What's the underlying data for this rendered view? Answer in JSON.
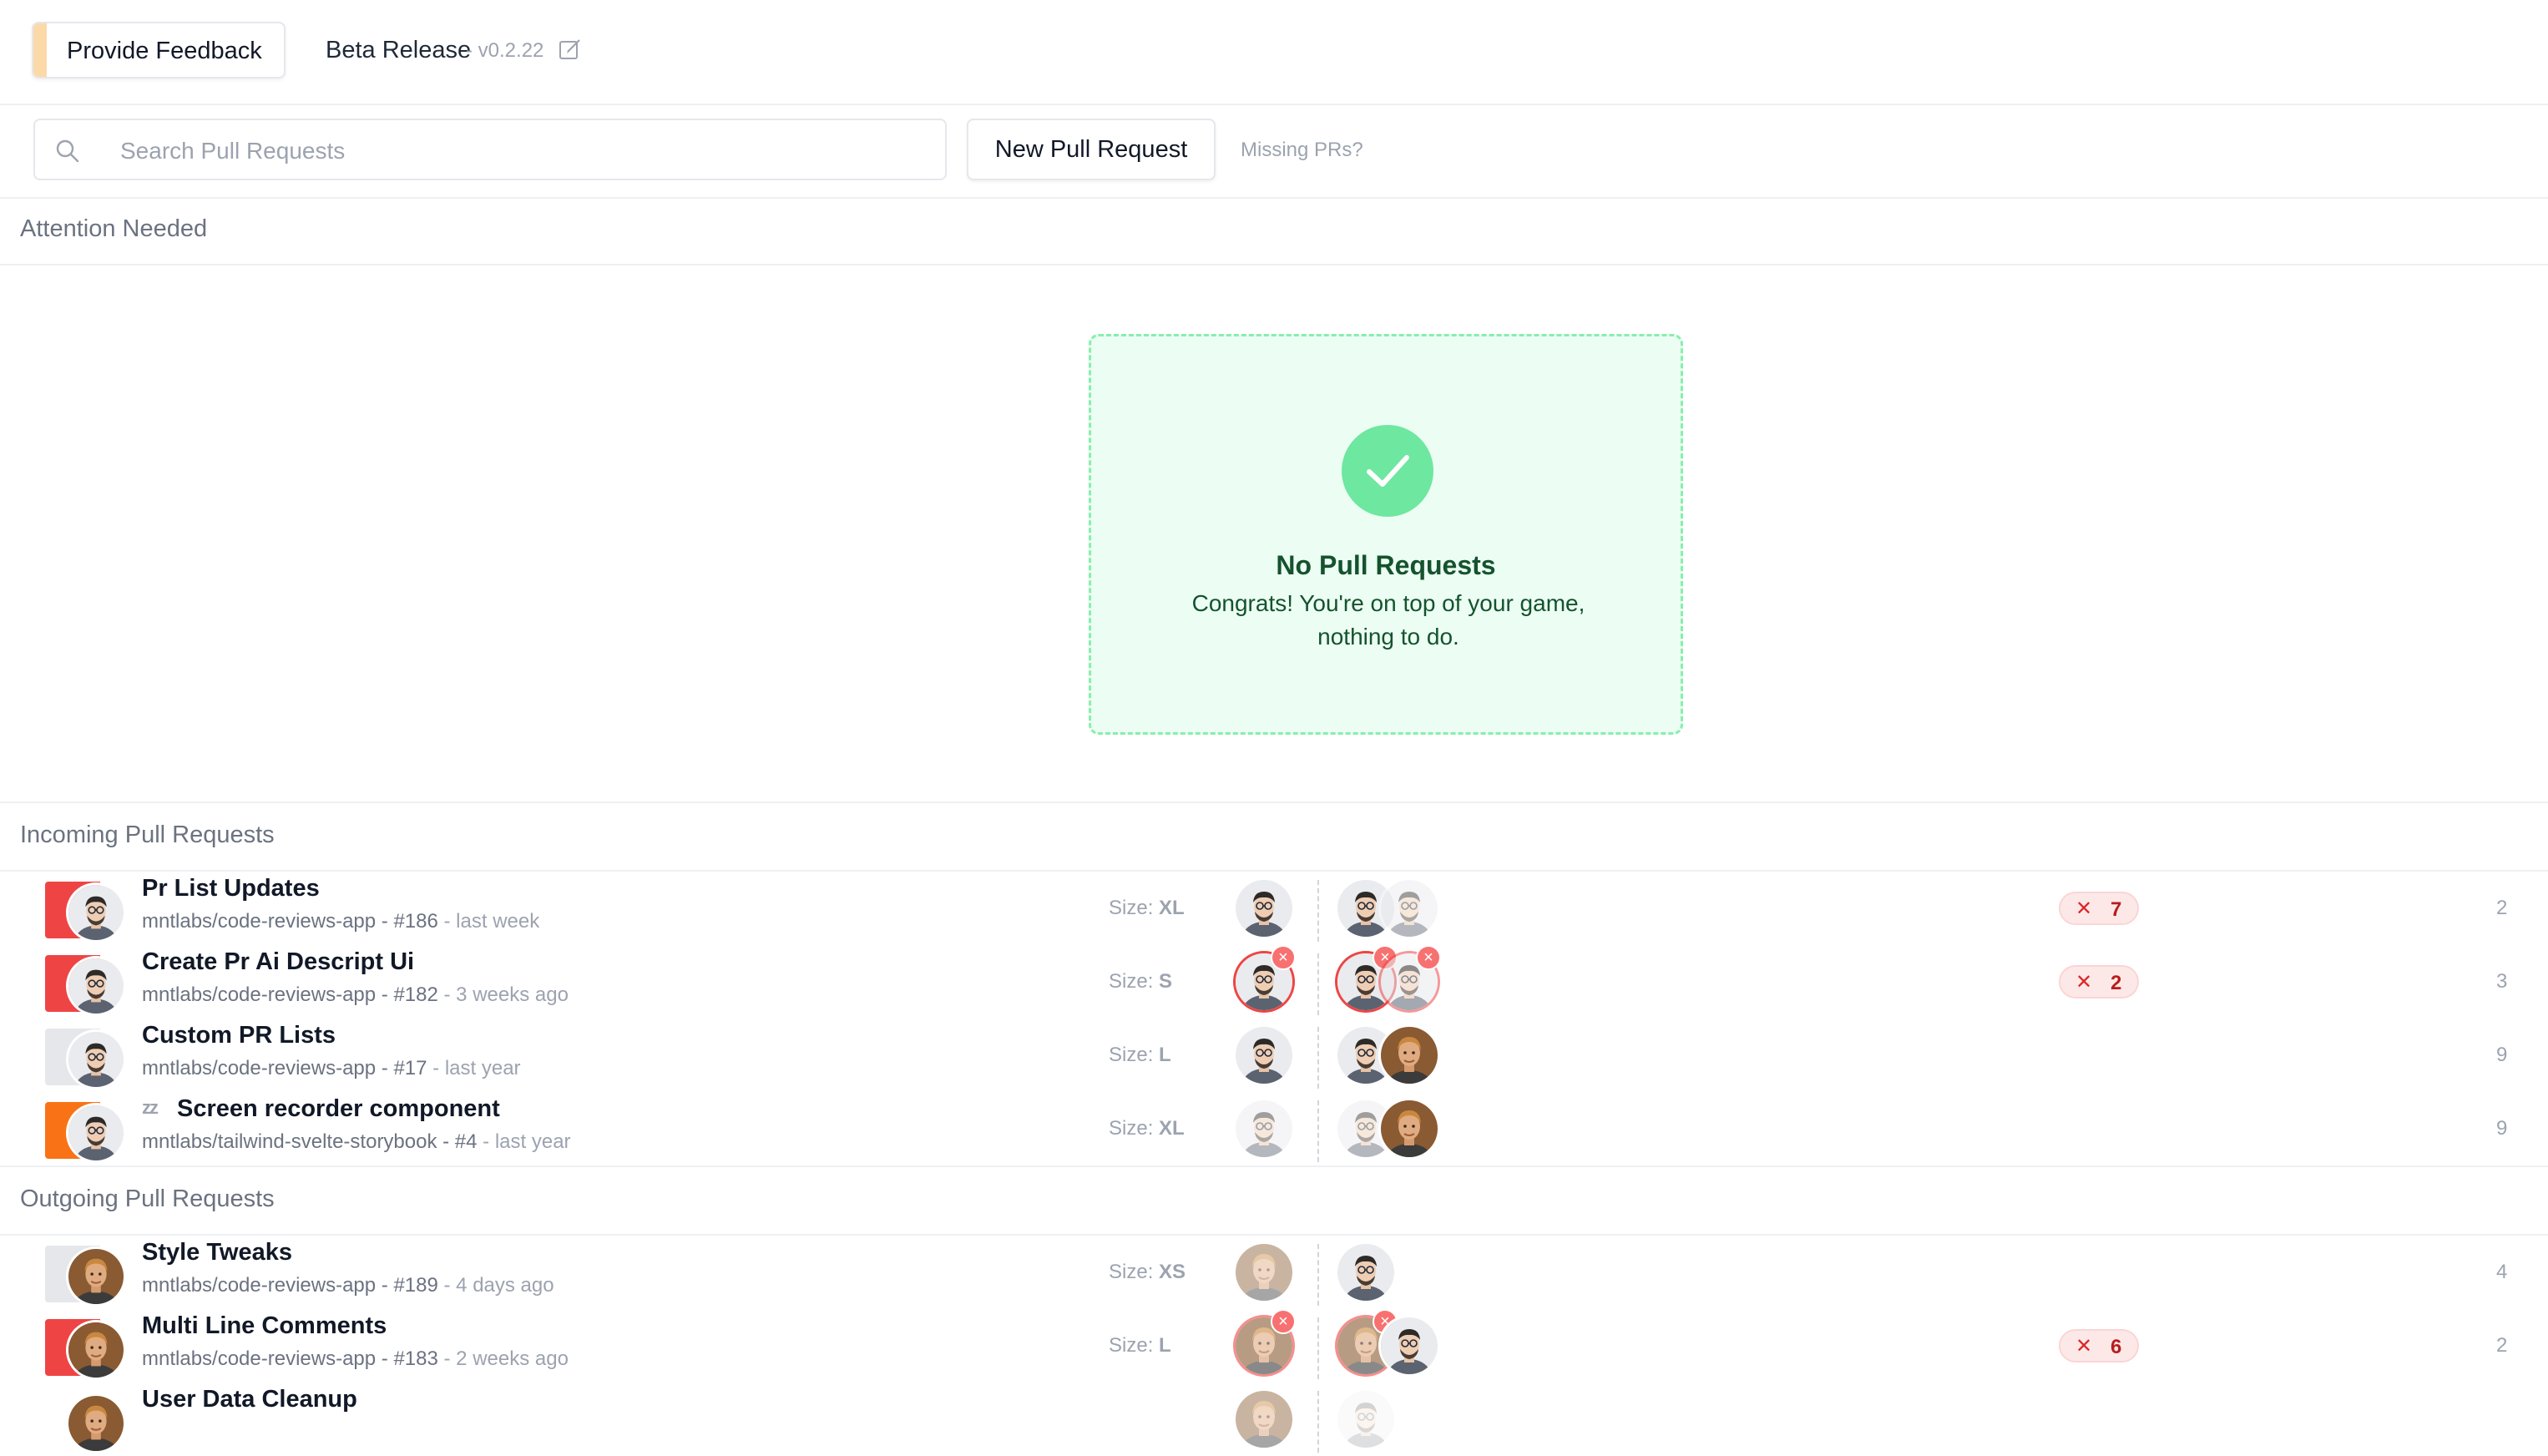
{
  "header": {
    "feedback_label": "Provide Feedback",
    "release_label": "Beta Release",
    "version": "- v0.2.22"
  },
  "toolbar": {
    "search_placeholder": "Search Pull Requests",
    "new_pr_label": "New Pull Request",
    "missing_label": "Missing PRs?"
  },
  "sections": {
    "attention": "Attention Needed",
    "incoming": "Incoming Pull Requests",
    "outgoing": "Outgoing Pull Requests"
  },
  "empty_state": {
    "title": "No Pull Requests",
    "subtitle": "Congrats! You're on top of your game, nothing to do."
  },
  "size_prefix": "Size:",
  "incoming": [
    {
      "title": "Pr List Updates",
      "repo": "mntlabs/code-reviews-app - #186",
      "ago": " - last week",
      "size": "XL",
      "status_color": "#ef4444",
      "comments": "7",
      "edge": "2"
    },
    {
      "title": "Create Pr Ai Descript Ui",
      "repo": "mntlabs/code-reviews-app - #182",
      "ago": " - 3 weeks ago",
      "size": "S",
      "status_color": "#ef4444",
      "comments": "2",
      "edge": "3"
    },
    {
      "title": "Custom PR Lists",
      "repo": "mntlabs/code-reviews-app - #17",
      "ago": " - last year",
      "size": "L",
      "status_color": "#e5e7eb",
      "comments": "",
      "edge": "9"
    },
    {
      "title": "Screen recorder component",
      "repo": "mntlabs/tailwind-svelte-storybook - #4",
      "ago": " - last year",
      "size": "XL",
      "status_color": "#f97316",
      "comments": "",
      "edge": "9",
      "snoozed_icon": "zz"
    }
  ],
  "outgoing": [
    {
      "title": "Style Tweaks",
      "repo": "mntlabs/code-reviews-app - #189",
      "ago": " - 4 days ago",
      "size": "XS",
      "status_color": "#e5e7eb",
      "comments": "",
      "edge": "4"
    },
    {
      "title": "Multi Line Comments",
      "repo": "mntlabs/code-reviews-app - #183",
      "ago": " - 2 weeks ago",
      "size": "L",
      "status_color": "#ef4444",
      "comments": "6",
      "edge": "2"
    },
    {
      "title": "User Data Cleanup",
      "repo": "",
      "ago": "",
      "size": "",
      "status_color": "#e5e7eb",
      "comments": "",
      "edge": ""
    }
  ]
}
